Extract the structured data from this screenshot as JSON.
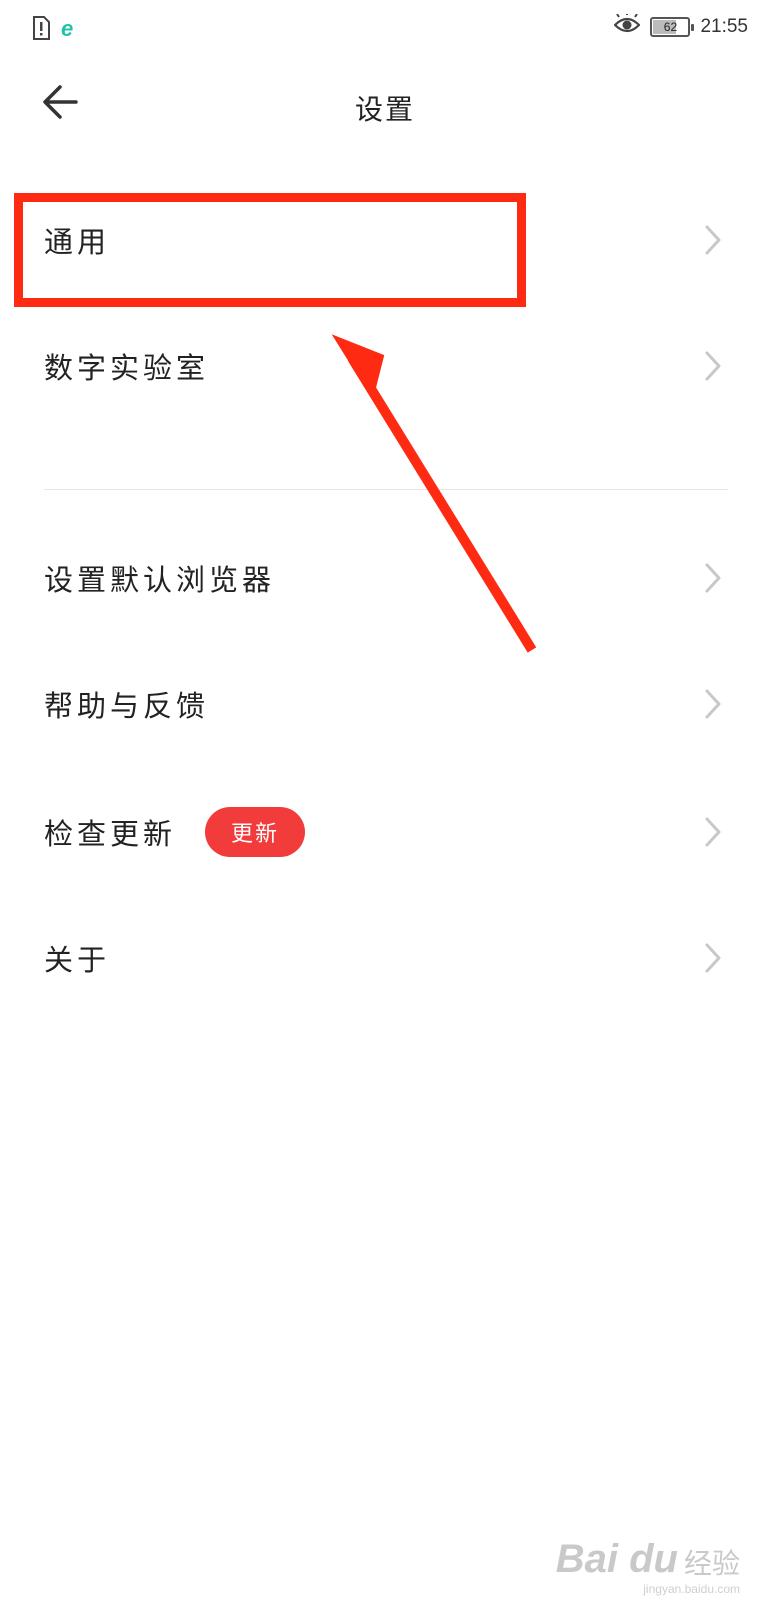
{
  "status_bar": {
    "time": "21:55",
    "battery_level": "62",
    "icons": [
      "sim-alert-icon",
      "browser-app-icon",
      "eye-icon",
      "battery-icon"
    ]
  },
  "header": {
    "title": "设置",
    "back_icon": "arrow-left-icon"
  },
  "menu": {
    "items": [
      {
        "label": "通用"
      },
      {
        "label": "数字实验室"
      },
      {
        "label": "设置默认浏览器"
      },
      {
        "label": "帮助与反馈"
      },
      {
        "label": "检查更新",
        "badge": "更新"
      },
      {
        "label": "关于"
      }
    ]
  },
  "colors": {
    "annotation": "#ff2a12",
    "badge": "#f23b3b",
    "chevron": "#c8c8c8",
    "browser_icon": "#1fc3a7"
  },
  "watermark": {
    "logo": "Bai du",
    "text": "经验",
    "url": "jingyan.baidu.com"
  }
}
